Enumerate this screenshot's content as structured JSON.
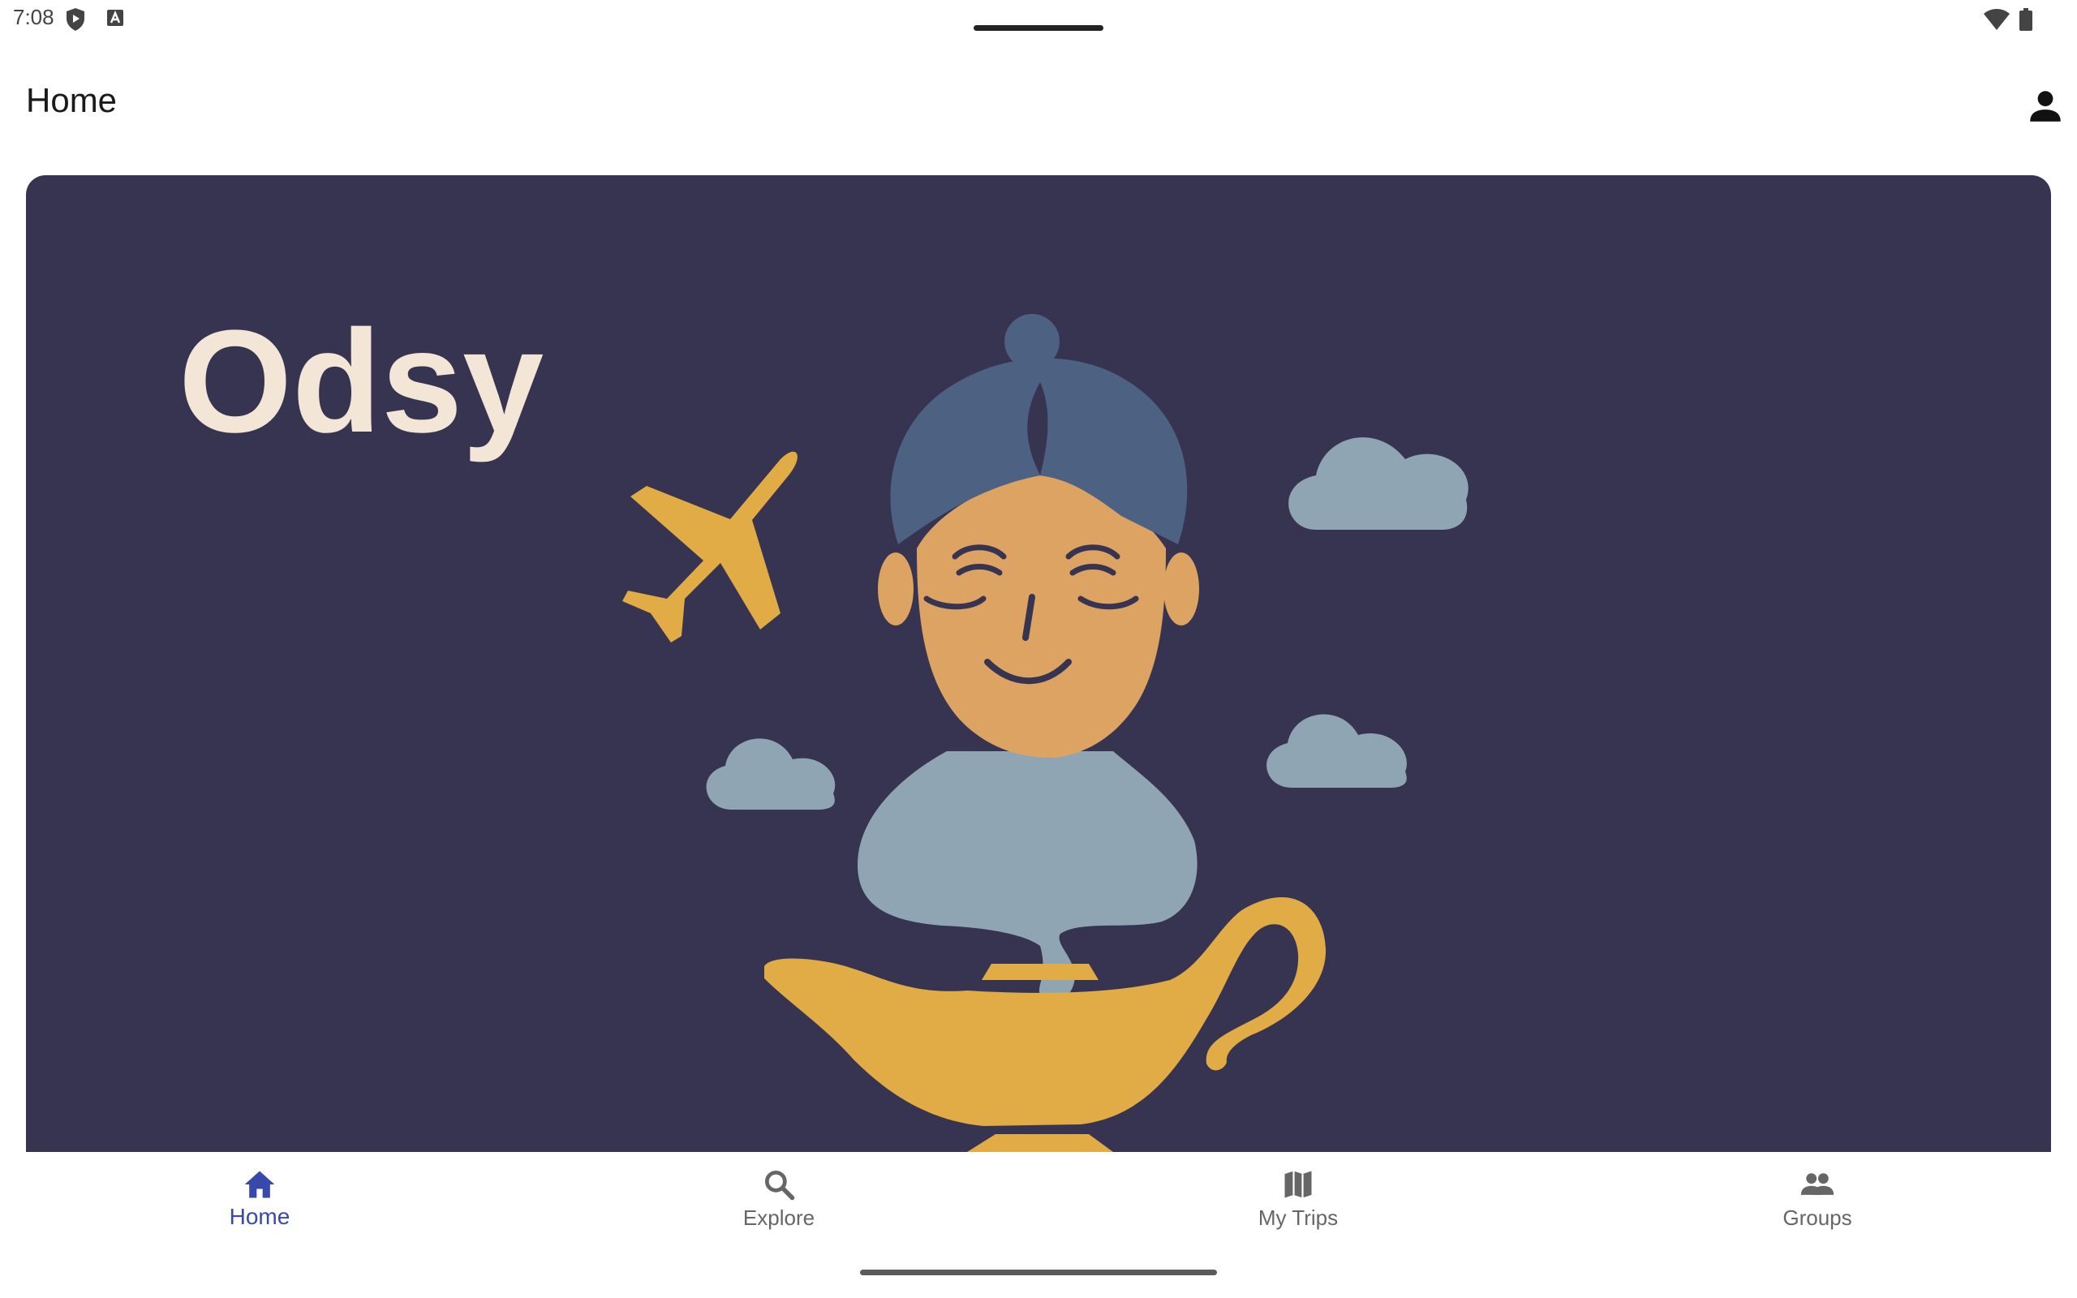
{
  "status_bar": {
    "time": "7:08",
    "left_icons": [
      "shield-play-icon",
      "a-box-icon"
    ],
    "right_icons": [
      "wifi-icon",
      "battery-icon"
    ]
  },
  "app_bar": {
    "title": "Home",
    "profile_icon": "person-icon"
  },
  "hero": {
    "logo_text": "Odsy",
    "background_color": "#373451",
    "illustration": "genie-lamp-with-airplane-and-clouds"
  },
  "bottom_nav": {
    "active_index": 0,
    "active_color": "#3949ab",
    "items": [
      {
        "label": "Home",
        "icon": "home-icon"
      },
      {
        "label": "Explore",
        "icon": "search-icon"
      },
      {
        "label": "My Trips",
        "icon": "map-icon"
      },
      {
        "label": "Groups",
        "icon": "groups-icon"
      }
    ]
  }
}
